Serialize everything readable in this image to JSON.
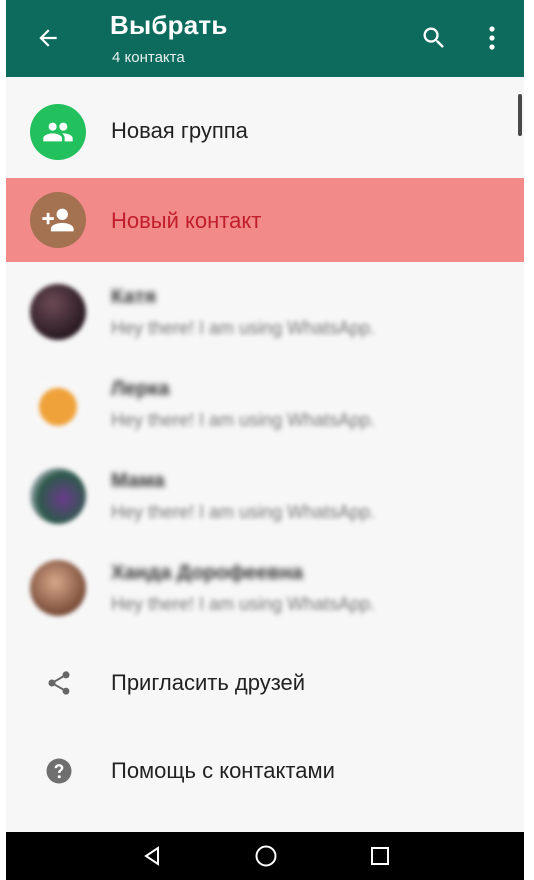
{
  "header": {
    "title": "Выбрать",
    "subtitle": "4 контакта",
    "background": "#0d6b5e"
  },
  "actions": {
    "new_group": "Новая группа",
    "new_contact": "Новый контакт",
    "invite_friends": "Пригласить друзей",
    "contacts_help": "Помощь с контактами"
  },
  "contacts": [
    {
      "name": "Катя",
      "status": "Hey there! I am using WhatsApp."
    },
    {
      "name": "Лерка",
      "status": "Hey there! I am using WhatsApp."
    },
    {
      "name": "Мама",
      "status": "Hey there! I am using WhatsApp."
    },
    {
      "name": "Ханда Дорофеевна",
      "status": "Hey there! I am using WhatsApp."
    }
  ],
  "colors": {
    "accent": "#0d6b5e",
    "group_avatar": "#22c15e",
    "highlight": "#f28a8a",
    "highlight_text": "#c01e2a"
  },
  "icons": [
    "back-arrow-icon",
    "search-icon",
    "more-vert-icon",
    "group-icon",
    "add-person-icon",
    "share-icon",
    "help-icon",
    "nav-back-icon",
    "nav-home-icon",
    "nav-recents-icon"
  ]
}
